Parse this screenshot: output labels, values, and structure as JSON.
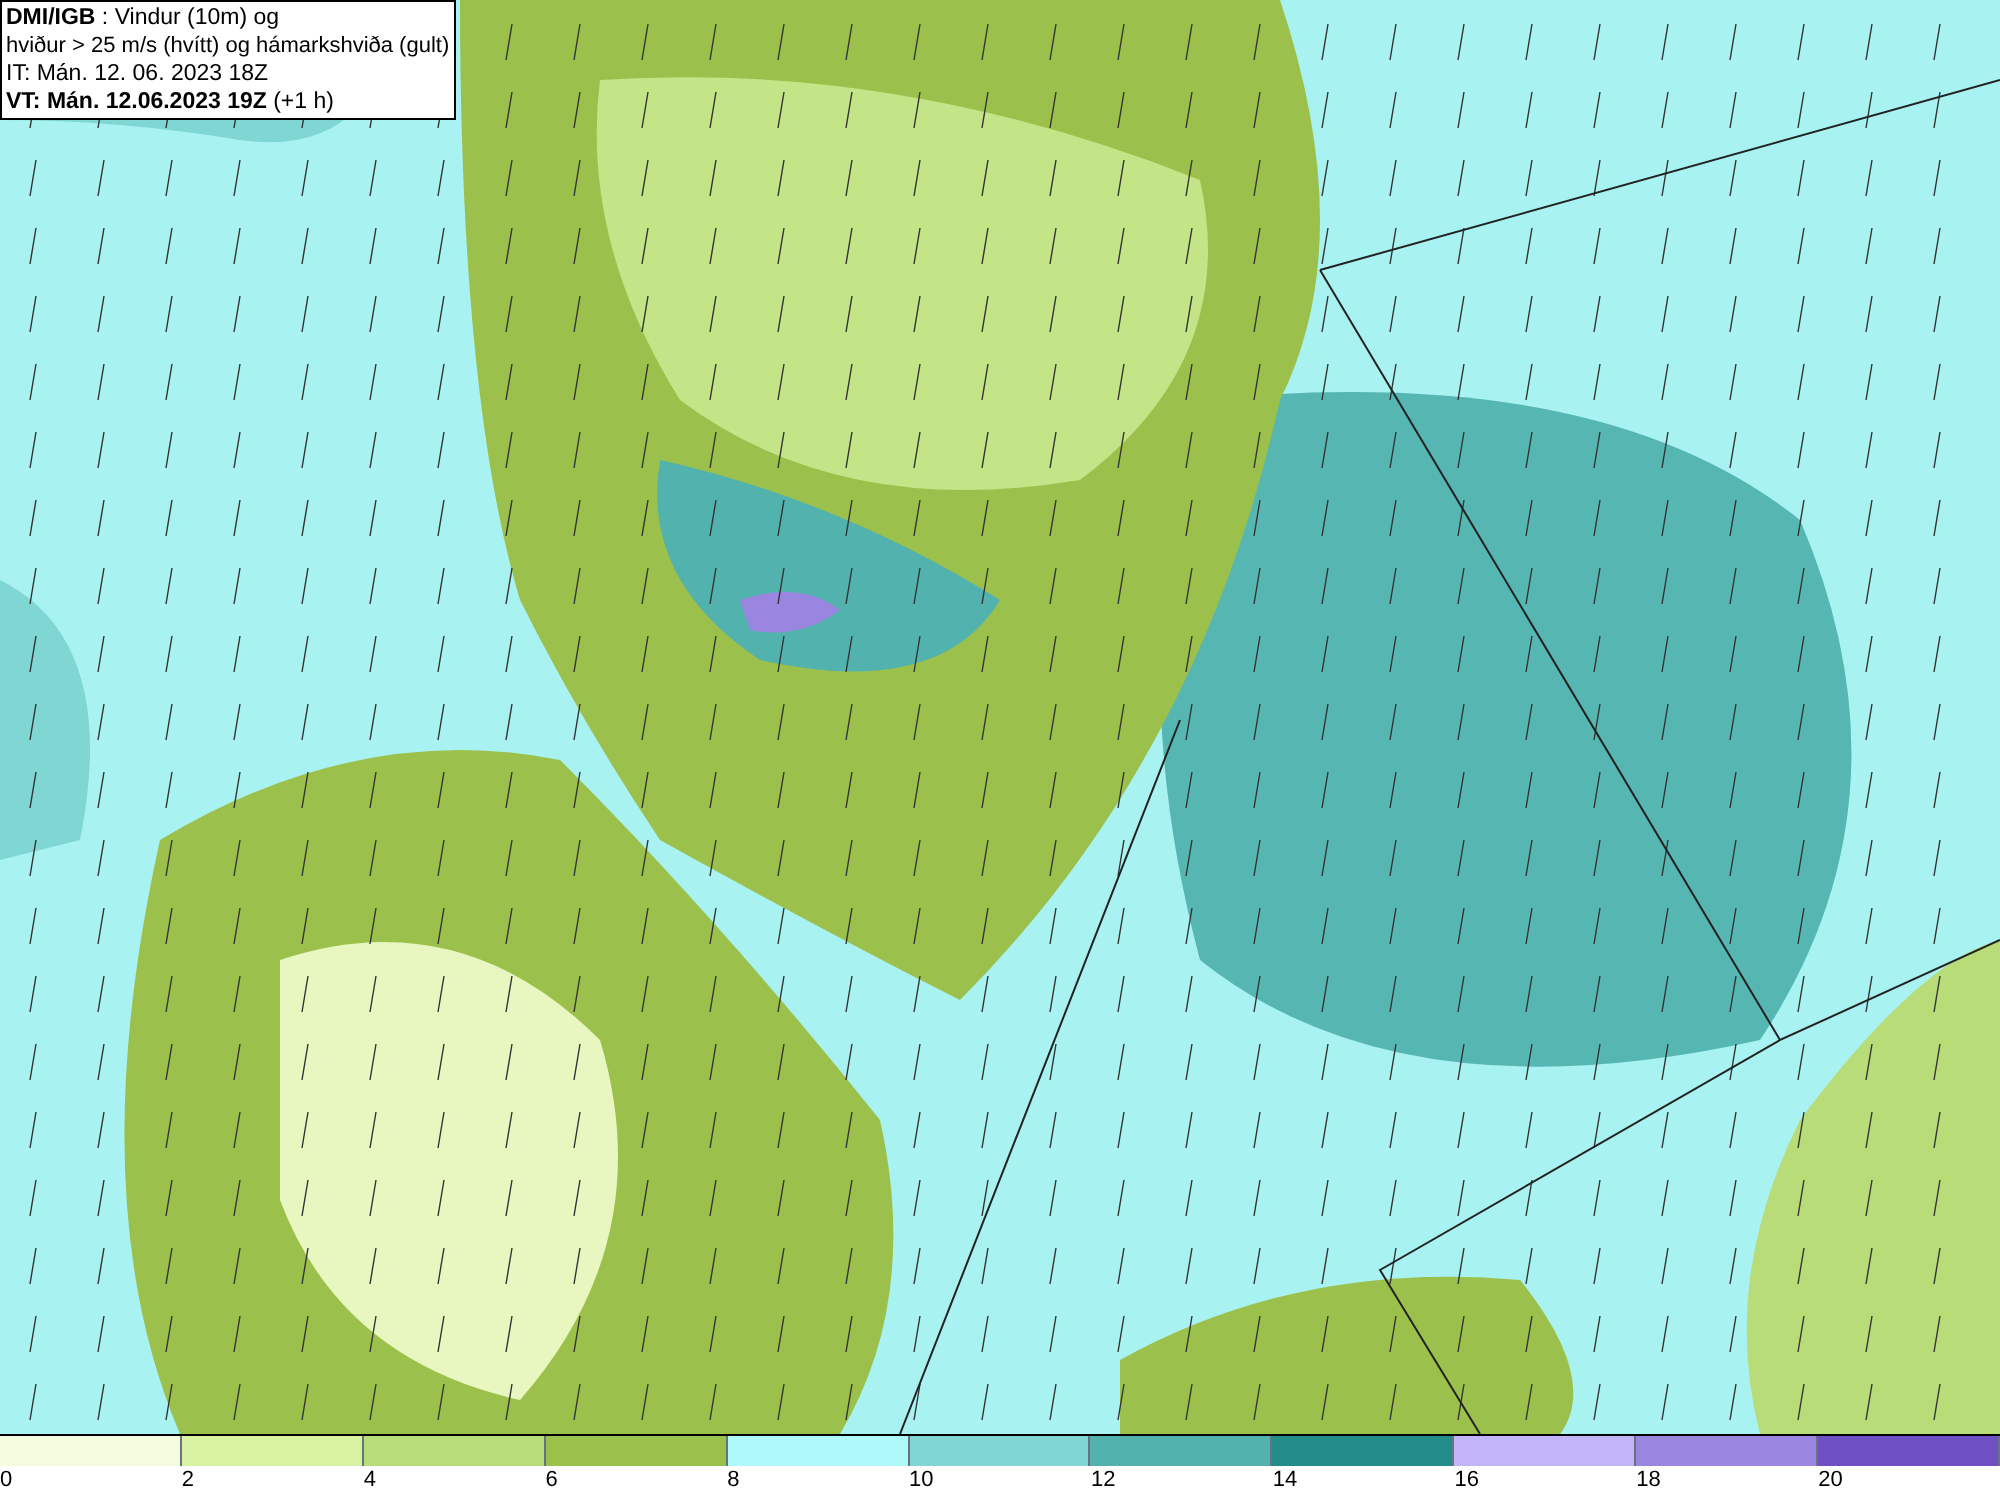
{
  "header": {
    "title": "**DMI/IGB** : Vindur (10m) og",
    "subtitle": "hviður > 25 m/s (hvítt) og hámarkshviða (gult)",
    "issue_time": "IT: Mán. 12. 06. 2023 18Z",
    "valid_time": "**VT: Mán. 12.06.2023 19Z** (+1 h)"
  },
  "legend": [
    {
      "label": "0",
      "color": "#f4fce0"
    },
    {
      "label": "2",
      "color": "#d8f2a2"
    },
    {
      "label": "4",
      "color": "#b8dc78"
    },
    {
      "label": "6",
      "color": "#9cc04c"
    },
    {
      "label": "8",
      "color": "#aefafa"
    },
    {
      "label": "10",
      "color": "#7fd6d2"
    },
    {
      "label": "12",
      "color": "#52b2ae"
    },
    {
      "label": "14",
      "color": "#228c8a"
    },
    {
      "label": "16",
      "color": "#c2b4f6"
    },
    {
      "label": "18",
      "color": "#9a86e0"
    },
    {
      "label": "20",
      "color": "#6e50c2"
    }
  ]
}
